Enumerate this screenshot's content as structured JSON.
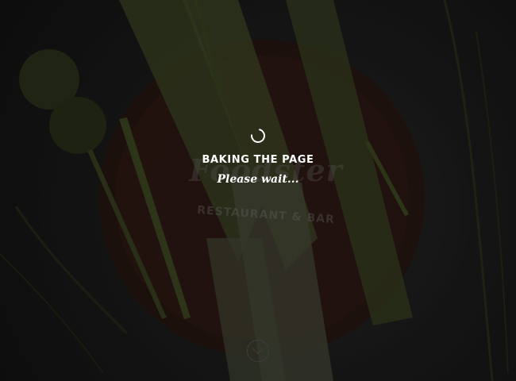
{
  "loader": {
    "title": "BAKING THE PAGE",
    "subtitle": "Please wait..."
  },
  "hero": {
    "logo_script": "Foodster",
    "logo_tagline": "RESTAURANT & BAR"
  },
  "icons": {
    "spinner": "loading-spinner-icon",
    "scroll": "chevron-down-icon"
  },
  "colors": {
    "text": "#ffffff",
    "background": "#141414",
    "board": "#3a1e16",
    "leek": "#4a5a2a"
  }
}
